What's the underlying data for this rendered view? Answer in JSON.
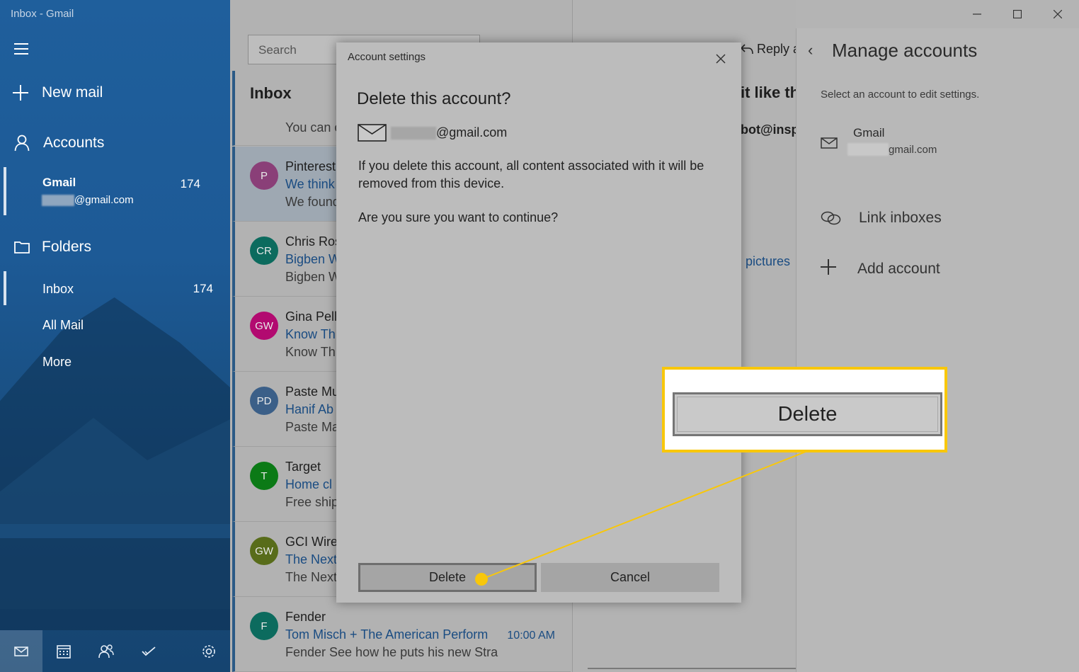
{
  "app": {
    "title": "Inbox - Gmail"
  },
  "sidebar": {
    "new_mail": "New mail",
    "accounts_label": "Accounts",
    "account": {
      "name": "Gmail",
      "count": "174",
      "email_suffix": "@gmail.com"
    },
    "folders_label": "Folders",
    "folders": [
      {
        "name": "Inbox",
        "count": "174"
      },
      {
        "name": "All Mail"
      },
      {
        "name": "More"
      }
    ],
    "bottom_icons": [
      "mail-icon",
      "calendar-icon",
      "people-icon",
      "todo-icon",
      "settings-icon"
    ]
  },
  "message_list": {
    "search_placeholder": "Search",
    "heading": "Inbox",
    "messages": [
      {
        "initials": "",
        "sender": "",
        "subject": "",
        "preview": "You can c",
        "avatar_color": "#c0385b"
      },
      {
        "initials": "P",
        "sender": "Pinterest",
        "subject": "We think",
        "preview": "We found",
        "avatar_color": "#8a3f78"
      },
      {
        "initials": "CR",
        "sender": "Chris Ros",
        "subject": "Bigben W",
        "preview": "Bigben W",
        "avatar_color": "#0c6b5e"
      },
      {
        "initials": "GW",
        "sender": "Gina Pell",
        "subject": "Know Th",
        "preview": "Know Th",
        "avatar_color": "#b20a70"
      },
      {
        "initials": "PD",
        "sender": "Paste Mu",
        "subject": "Hanif Ab",
        "preview": "Paste Ma",
        "avatar_color": "#3b5f88"
      },
      {
        "initials": "T",
        "sender": "Target",
        "subject": "Home cl",
        "preview": "Free ship",
        "avatar_color": "#0b7a16"
      },
      {
        "initials": "GW",
        "sender": "GCI Wire",
        "subject": "The Next",
        "preview": "The Next",
        "avatar_color": "#586c1a"
      },
      {
        "initials": "F",
        "sender": "Fender",
        "subject": "Tom Misch + The American Perform",
        "preview": "Fender See how he puts his new Stra",
        "time": "10:00 AM",
        "avatar_color": "#0c6b5e"
      }
    ]
  },
  "reading_pane": {
    "reply": "Reply a",
    "subject_fragment": "it like th",
    "from_fragment": "bot@insp",
    "pictures_fragment": "l pictures"
  },
  "manage_accounts": {
    "title": "Manage accounts",
    "instruction": "Select an account to edit settings.",
    "account": {
      "name": "Gmail",
      "email_suffix": "gmail.com"
    },
    "link_inboxes": "Link inboxes",
    "add_account": "Add account"
  },
  "dialog": {
    "title": "Account settings",
    "heading": "Delete this account?",
    "account_suffix": "@gmail.com",
    "message": "If you delete this account, all content associated with it will be removed from this device.",
    "confirm": "Are you sure you want to continue?",
    "delete_label": "Delete",
    "cancel_label": "Cancel"
  },
  "callout": {
    "label": "Delete",
    "color": "#f8c70b"
  }
}
